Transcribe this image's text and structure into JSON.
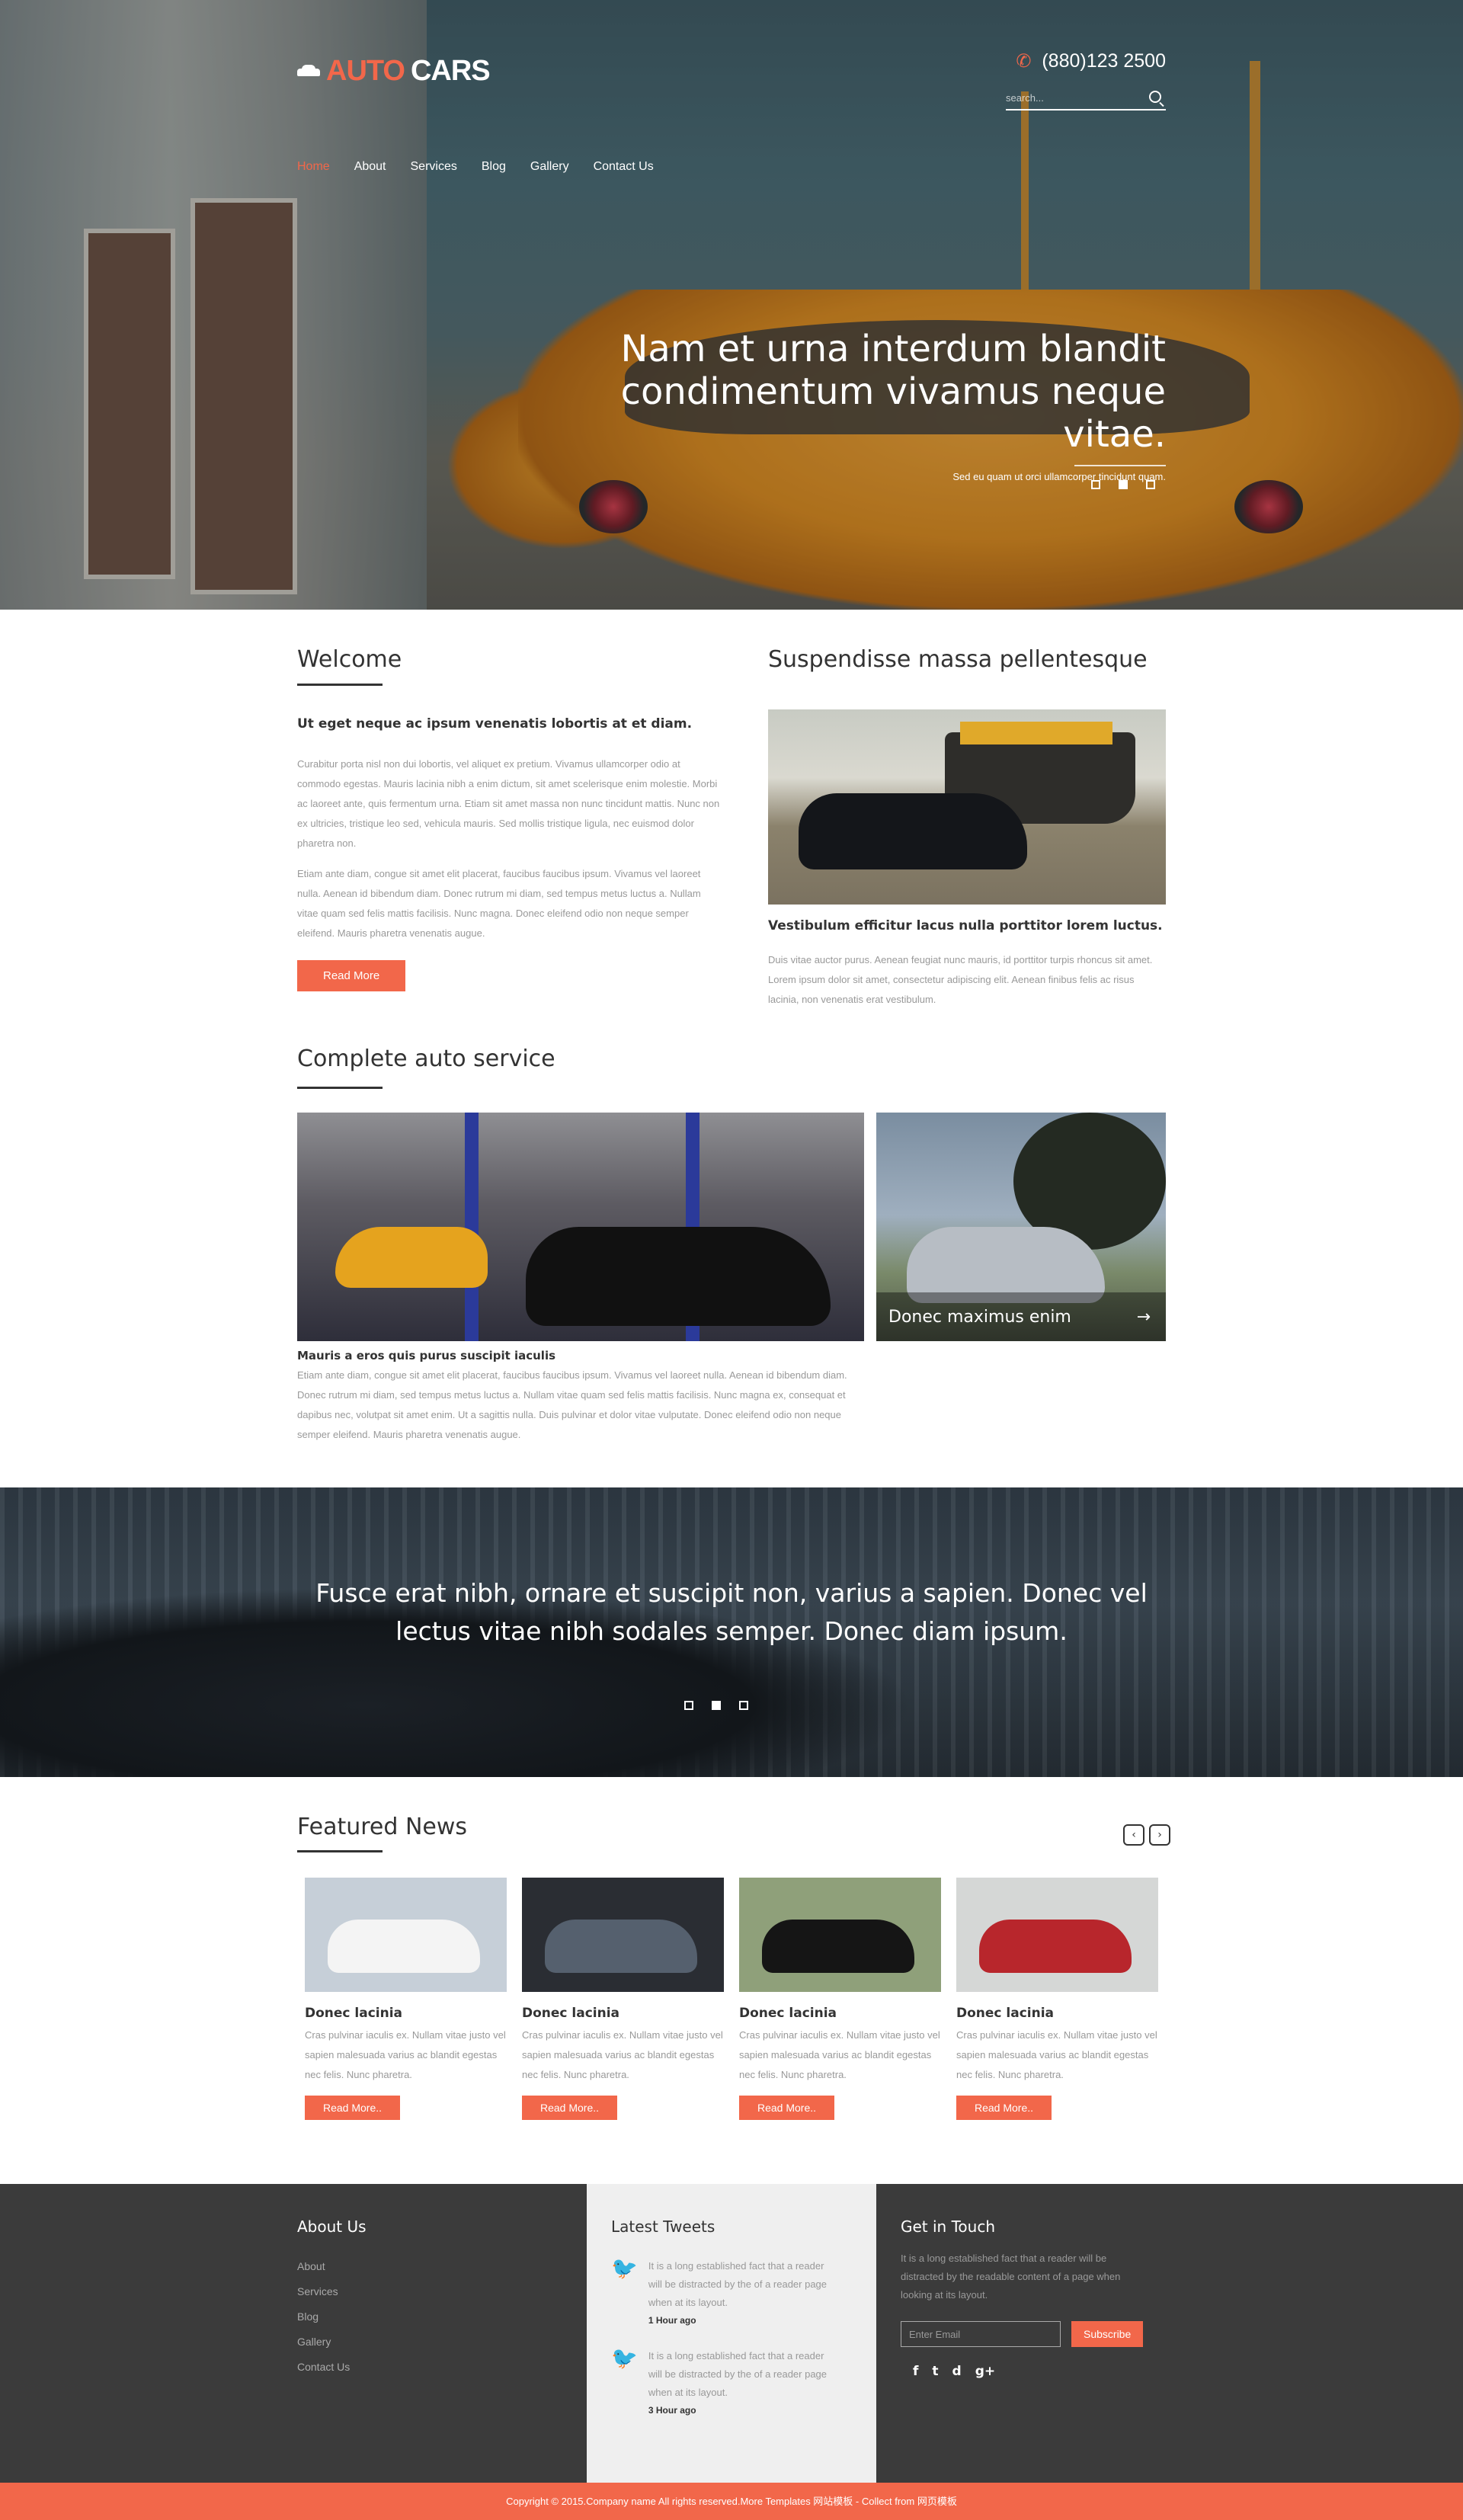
{
  "brand": {
    "part1": "AUTO",
    "part2": "CARS"
  },
  "header": {
    "phone": "(880)123 2500",
    "search_placeholder": "search..."
  },
  "nav": [
    "Home",
    "About",
    "Services",
    "Blog",
    "Gallery",
    "Contact Us"
  ],
  "hero": {
    "headline": "Nam et urna interdum blandit condimentum vivamus neque vitae.",
    "subtext": "Sed eu quam ut orci ullamcorper tincidunt quam.",
    "slide_count": 3,
    "active_slide": 2
  },
  "welcome": {
    "title": "Welcome",
    "lead": "Ut eget neque ac ipsum venenatis lobortis at et diam.",
    "para1": "Curabitur porta nisl non dui lobortis, vel aliquet ex pretium. Vivamus ullamcorper odio at commodo egestas. Mauris lacinia nibh a enim dictum, sit amet scelerisque enim molestie. Morbi ac laoreet ante, quis fermentum urna. Etiam sit amet massa non nunc tincidunt mattis. Nunc non ex ultricies, tristique leo sed, vehicula mauris. Sed mollis tristique ligula, nec euismod dolor pharetra non.",
    "para2": "Etiam ante diam, congue sit amet elit placerat, faucibus faucibus ipsum. Vivamus vel laoreet nulla. Aenean id bibendum diam. Donec rutrum mi diam, sed tempus metus luctus a. Nullam vitae quam sed felis mattis facilisis. Nunc magna. Donec eleifend odio non neque semper eleifend. Mauris pharetra venenatis augue.",
    "button": "Read More"
  },
  "suspendisse": {
    "title": "Suspendisse massa pellentesque",
    "caption": "Vestibulum efficitur lacus nulla porttitor lorem luctus.",
    "text": "Duis vitae auctor purus. Aenean feugiat nunc mauris, id porttitor turpis rhoncus sit amet. Lorem ipsum dolor sit amet, consectetur adipiscing elit. Aenean finibus felis ac risus lacinia, non venenatis erat vestibulum."
  },
  "service": {
    "title": "Complete auto service",
    "side_caption": "Donec maximus enim",
    "caption_title": "Mauris a eros quis purus suscipit iaculis",
    "caption_text": "Etiam ante diam, congue sit amet elit placerat, faucibus faucibus ipsum. Vivamus vel laoreet nulla. Aenean id bibendum diam. Donec rutrum mi diam, sed tempus metus luctus a. Nullam vitae quam sed felis mattis facilisis. Nunc magna ex, consequat et dapibus nec, volutpat sit amet enim. Ut a sagittis nulla. Duis pulvinar et dolor vitae vulputate. Donec eleifend odio non neque semper eleifend. Mauris pharetra venenatis augue."
  },
  "quote": {
    "text": "Fusce erat nibh, ornare et suscipit non, varius a sapien. Donec vel lectus vitae nibh sodales semper. Donec diam ipsum.",
    "slide_count": 3,
    "active_slide": 2
  },
  "news": {
    "title": "Featured News",
    "items": [
      {
        "title": "Donec lacinia",
        "text": "Cras pulvinar iaculis ex. Nullam vitae justo vel sapien malesuada varius ac blandit egestas nec felis. Nunc pharetra.",
        "button": "Read More..",
        "img_bg": "#c6cfd8",
        "car_color": "#f4f4f4"
      },
      {
        "title": "Donec lacinia",
        "text": "Cras pulvinar iaculis ex. Nullam vitae justo vel sapien malesuada varius ac blandit egestas nec felis. Nunc pharetra.",
        "button": "Read More..",
        "img_bg": "#2a2d33",
        "car_color": "#55606e"
      },
      {
        "title": "Donec lacinia",
        "text": "Cras pulvinar iaculis ex. Nullam vitae justo vel sapien malesuada varius ac blandit egestas nec felis. Nunc pharetra.",
        "button": "Read More..",
        "img_bg": "#8fa07a",
        "car_color": "#151515"
      },
      {
        "title": "Donec lacinia",
        "text": "Cras pulvinar iaculis ex. Nullam vitae justo vel sapien malesuada varius ac blandit egestas nec felis. Nunc pharetra.",
        "button": "Read More..",
        "img_bg": "#d5d7d6",
        "car_color": "#b8262c"
      }
    ]
  },
  "footer": {
    "about_title": "About Us",
    "about_links": [
      "About",
      "Services",
      "Blog",
      "Gallery",
      "Contact Us"
    ],
    "tweets_title": "Latest Tweets",
    "tweets": [
      {
        "text": "It is a long established fact that a reader will be distracted by the of a reader page when at its layout.",
        "time": "1 Hour ago"
      },
      {
        "text": "It is a long established fact that a reader will be distracted by the of a reader page when at its layout.",
        "time": "3 Hour ago"
      }
    ],
    "touch_title": "Get in Touch",
    "touch_text": "It is a long established fact that a reader will be distracted by the readable content of a page when looking at its layout.",
    "email_placeholder": "Enter Email",
    "subscribe": "Subscribe",
    "socials": [
      "f",
      "t",
      "d",
      "g+"
    ]
  },
  "copyright": "Copyright © 2015.Company name All rights reserved.More Templates 网站模板 - Collect from 网页模板",
  "colors": {
    "accent": "#f2674a",
    "dark": "#3b3b3b"
  }
}
